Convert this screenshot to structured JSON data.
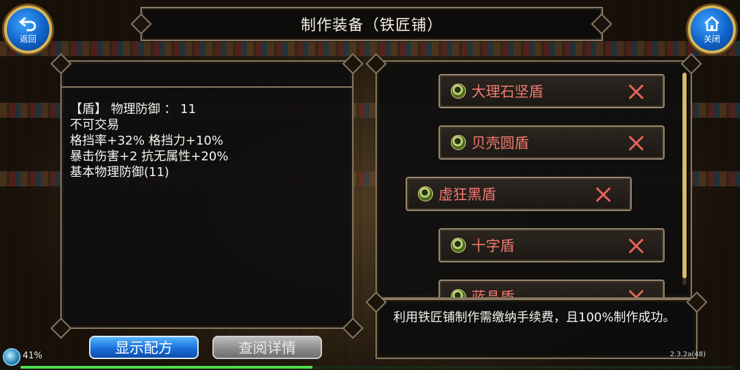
{
  "title": "制作装备（铁匠铺）",
  "back_button": {
    "label": "返回",
    "icon": "back-arrow-icon"
  },
  "close_button": {
    "label": "关闭",
    "icon": "house-icon"
  },
  "description": {
    "lines": [
      "【盾】 物理防御 ： 11",
      "不可交易",
      "格挡率+32% 格挡力+10%",
      "暴击伤害+2 抗无属性+20%",
      "基本物理防御(11)"
    ]
  },
  "items": [
    {
      "name": "大理石坚盾",
      "icon": "gem-icon",
      "selected": false
    },
    {
      "name": "贝壳圆盾",
      "icon": "gem-icon",
      "selected": false
    },
    {
      "name": "虚狂黑盾",
      "icon": "gem-icon",
      "selected": true
    },
    {
      "name": "十字盾",
      "icon": "gem-icon",
      "selected": false
    },
    {
      "name": "蓝晶盾",
      "icon": "gem-icon",
      "selected": false
    }
  ],
  "info_text": "利用铁匠铺制作需缴纳手续费，且100%制作成功。",
  "buttons": {
    "show_recipe": "显示配方",
    "view_details": "查阅详情"
  },
  "status": {
    "battery_percent": "41%",
    "progress": 0.41,
    "version": "2.3.2a(48)"
  },
  "colors": {
    "item_name": "#f07a70",
    "accent_blue": "#1a6fd8",
    "border_gold": "#8a7a62"
  }
}
